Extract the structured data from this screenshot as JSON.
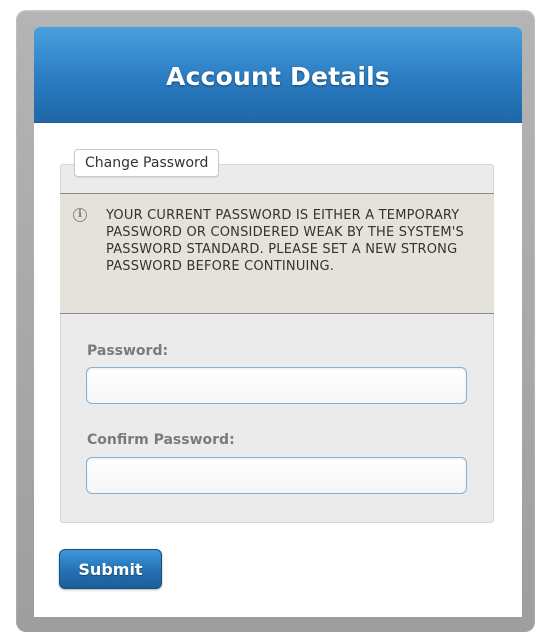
{
  "header": {
    "title": "Account Details"
  },
  "form": {
    "section_legend": "Change Password",
    "notice": {
      "icon": "info-icon",
      "text": "YOUR CURRENT PASSWORD IS EITHER A TEMPORARY PASSWORD OR CONSIDERED WEAK BY THE SYSTEM'S PASSWORD STANDARD. PLEASE SET A NEW STRONG PASSWORD BEFORE CONTINUING."
    },
    "fields": {
      "password": {
        "label": "Password:",
        "value": ""
      },
      "confirm_password": {
        "label": "Confirm Password:",
        "value": ""
      }
    },
    "submit_label": "Submit"
  },
  "colors": {
    "header_blue": "#2b7cc2",
    "button_blue": "#2371b3",
    "notice_background": "#e4e2db",
    "fieldset_background": "#ebebeb"
  }
}
